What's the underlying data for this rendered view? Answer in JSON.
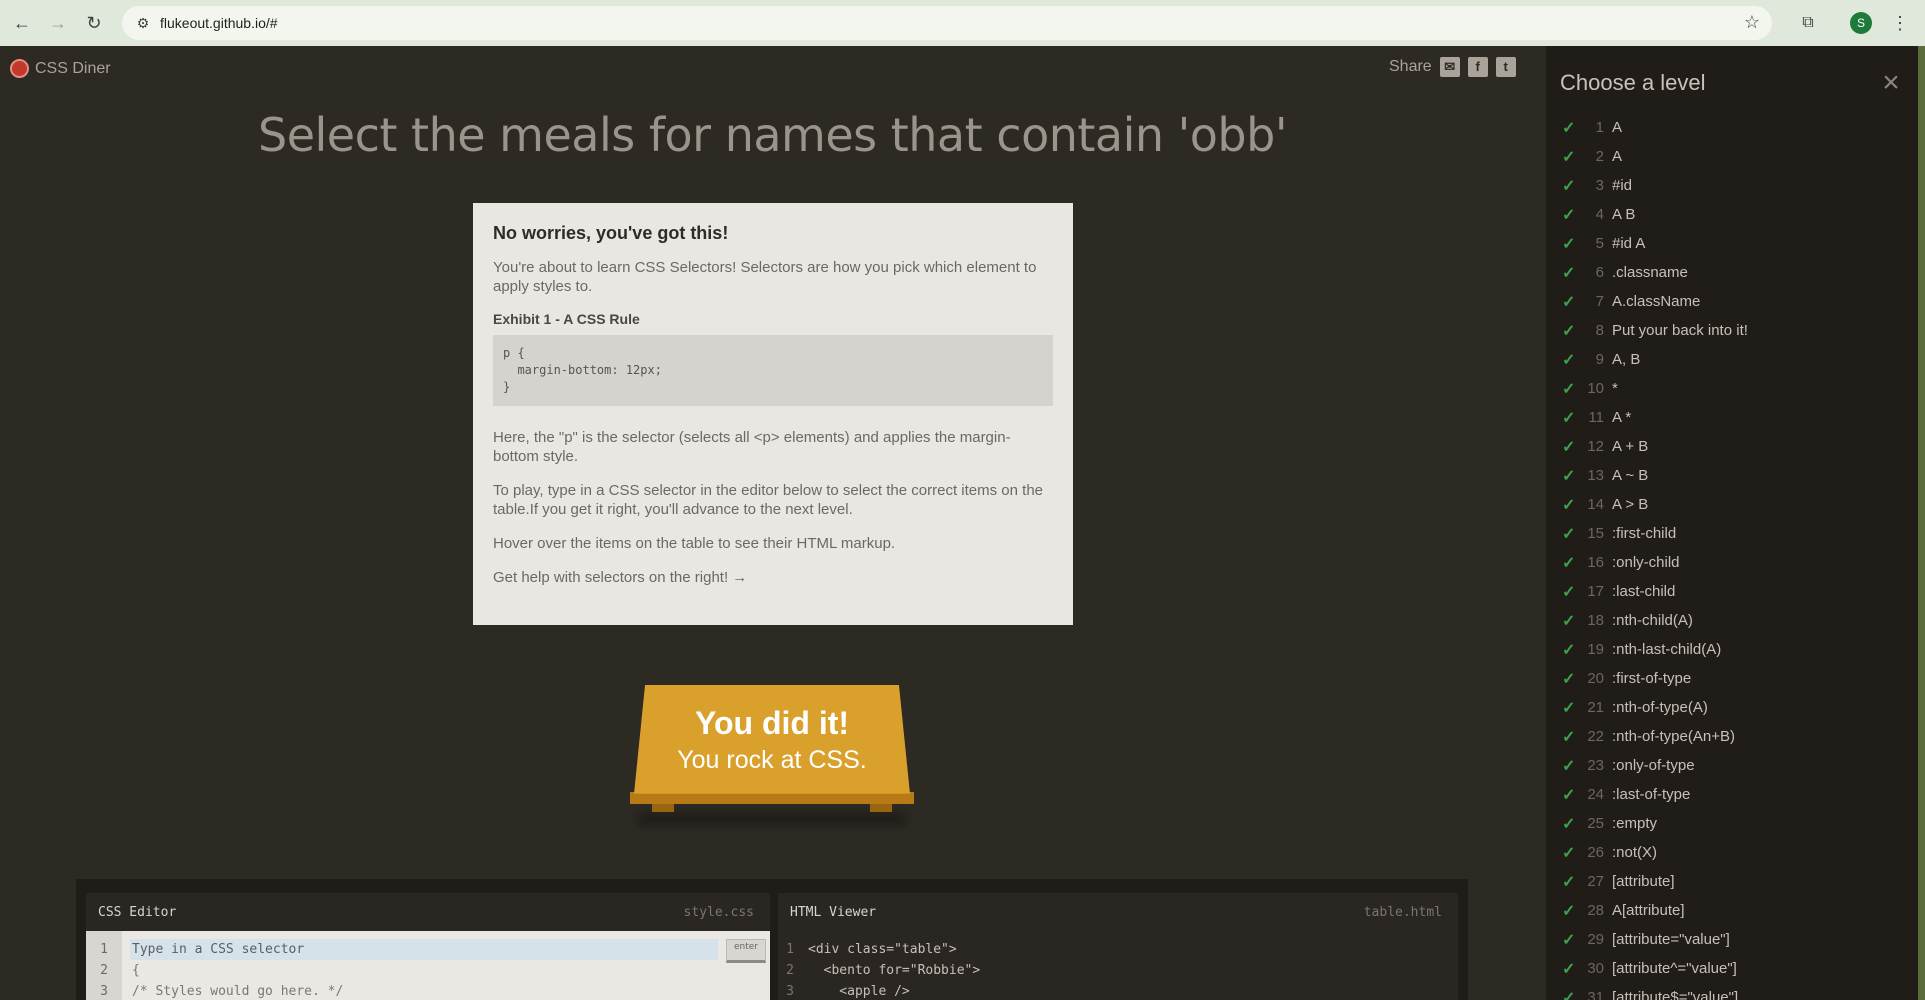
{
  "browser": {
    "url": "flukeout.github.io/#",
    "profile_initial": "S",
    "icons": {
      "back": "arrow-left-icon",
      "forward": "arrow-right-icon",
      "reload": "reload-icon",
      "site_info": "tune-icon",
      "bookmark": "star-icon",
      "extensions": "puzzle-icon",
      "menu": "kebab-icon"
    }
  },
  "app": {
    "logo_text": "CSS Diner",
    "share_label": "Share",
    "headline": "Select the meals for names that contain 'obb'"
  },
  "modal": {
    "title": "No worries, you've got this!",
    "p1": "You're about to learn CSS Selectors! Selectors are how you pick which element to apply styles to.",
    "exhibit_label": "Exhibit 1 - A CSS Rule",
    "code": "p {\n  margin-bottom: 12px;\n}",
    "p2": "Here, the \"p\" is the selector (selects all <p> elements) and applies the margin-bottom style.",
    "p3": "To play, type in a CSS selector in the editor below to select the correct items on the table.If you get it right, you'll advance to the next level.",
    "p4": "Hover over the items on the table to see their HTML markup.",
    "p5": "Get help with selectors on the right! →"
  },
  "win": {
    "line1": "You did it!",
    "line2": "You rock at CSS."
  },
  "editor": {
    "css_title": "CSS Editor",
    "css_file": "style.css",
    "html_title": "HTML Viewer",
    "html_file": "table.html",
    "input_placeholder": "Type in a CSS selector",
    "enter_label": "enter",
    "css_lines": [
      "1",
      "2",
      "3"
    ],
    "css_code": "{\n/* Styles would go here. */",
    "html_lines": [
      "1",
      "2",
      "3"
    ],
    "html_code": "<div class=\"table\">\n  <bento for=\"Robbie\">\n    <apple />"
  },
  "sidebar": {
    "title": "Choose a level",
    "levels": [
      {
        "num": "1",
        "name": "A"
      },
      {
        "num": "2",
        "name": "A"
      },
      {
        "num": "3",
        "name": "#id"
      },
      {
        "num": "4",
        "name": "A  B"
      },
      {
        "num": "5",
        "name": "#id  A"
      },
      {
        "num": "6",
        "name": ".classname"
      },
      {
        "num": "7",
        "name": "A.className"
      },
      {
        "num": "8",
        "name": "Put your back into it!"
      },
      {
        "num": "9",
        "name": "A, B"
      },
      {
        "num": "10",
        "name": "*"
      },
      {
        "num": "11",
        "name": "A  *"
      },
      {
        "num": "12",
        "name": "A + B"
      },
      {
        "num": "13",
        "name": "A ~ B"
      },
      {
        "num": "14",
        "name": "A > B"
      },
      {
        "num": "15",
        "name": ":first-child"
      },
      {
        "num": "16",
        "name": ":only-child"
      },
      {
        "num": "17",
        "name": ":last-child"
      },
      {
        "num": "18",
        "name": ":nth-child(A)"
      },
      {
        "num": "19",
        "name": ":nth-last-child(A)"
      },
      {
        "num": "20",
        "name": ":first-of-type"
      },
      {
        "num": "21",
        "name": ":nth-of-type(A)"
      },
      {
        "num": "22",
        "name": ":nth-of-type(An+B)"
      },
      {
        "num": "23",
        "name": ":only-of-type"
      },
      {
        "num": "24",
        "name": ":last-of-type"
      },
      {
        "num": "25",
        "name": ":empty"
      },
      {
        "num": "26",
        "name": ":not(X)"
      },
      {
        "num": "27",
        "name": "[attribute]"
      },
      {
        "num": "28",
        "name": "A[attribute]"
      },
      {
        "num": "29",
        "name": "[attribute=\"value\"]"
      },
      {
        "num": "30",
        "name": "[attribute^=\"value\"]"
      },
      {
        "num": "31",
        "name": "[attribute$=\"value\"]"
      }
    ]
  }
}
